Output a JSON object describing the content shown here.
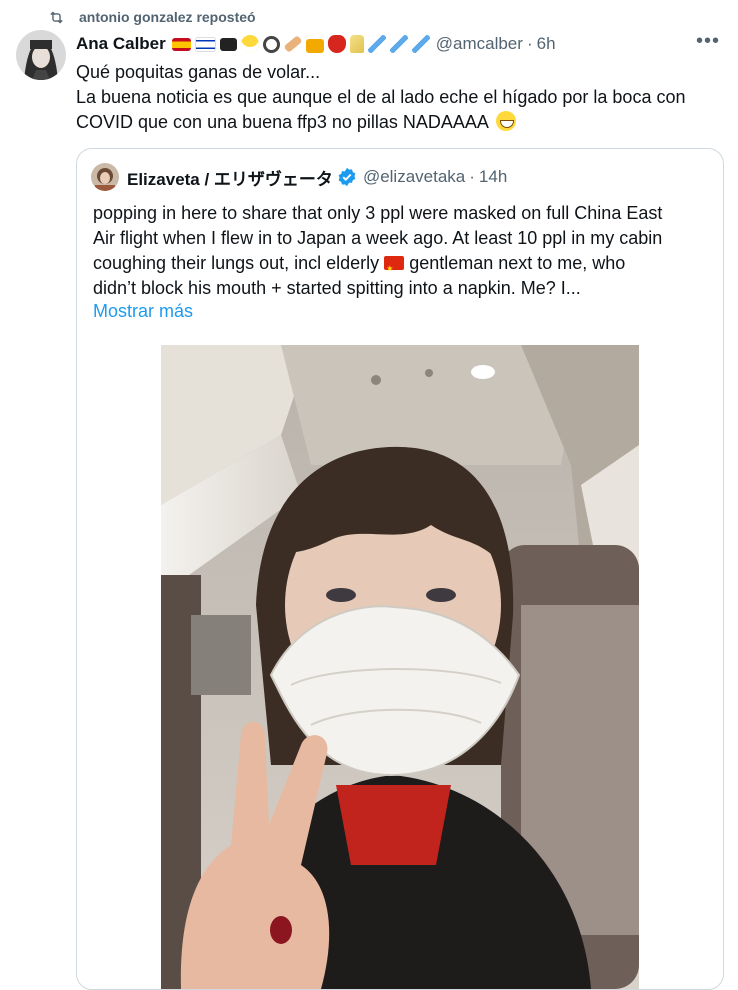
{
  "repost": {
    "text": "antonio gonzalez reposteó",
    "icon": "repost-icon"
  },
  "tweet": {
    "author_name": "Ana Calber",
    "handle": "@amcalber",
    "separator": "·",
    "time": "6h",
    "more_icon": "more-horizontal-icon",
    "lines": [
      "Qué poquitas ganas de volar...",
      "La buena noticia es que aunque el de al lado  eche el hígado por la boca con",
      "COVID que con una buena ffp3 no pillas NADAAAA"
    ],
    "name_emojis": [
      "spain-flag",
      "israel-flag",
      "pirate-flag",
      "mask-face",
      "magnifier",
      "bandage",
      "beer-mugs",
      "lobster",
      "champagne",
      "syringe",
      "syringe",
      "syringe"
    ]
  },
  "quote": {
    "author_name": "Elizaveta / エリザヴェータ",
    "handle": "@elizavetaka",
    "separator": "·",
    "time": "14h",
    "verified_icon": "verified-badge-icon",
    "line1": "popping in here to share that only 3 ppl were masked on full China East",
    "line2": "Air flight when I flew in to Japan a week ago. At least 10 ppl in my cabin",
    "line3a": "coughing their lungs out, incl elderly",
    "line3b": " gentleman next to me, who",
    "line4": "didn’t block his mouth + started spitting into a napkin. Me? I...",
    "show_more": "Mostrar más"
  },
  "colors": {
    "accent": "#1d9bf0",
    "secondary_text": "#536471",
    "border": "#cfd9de"
  }
}
